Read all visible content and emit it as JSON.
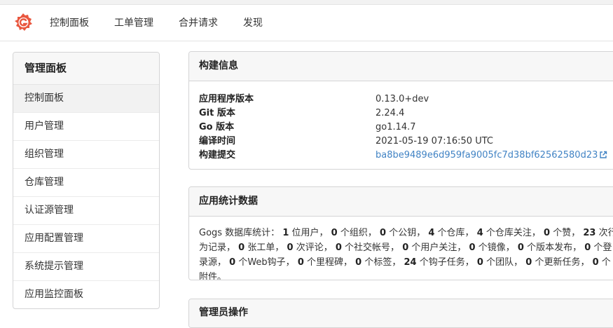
{
  "nav": {
    "items": [
      "控制面板",
      "工单管理",
      "合并请求",
      "发现"
    ]
  },
  "sidebar": {
    "title": "管理面板",
    "items": [
      {
        "label": "控制面板",
        "active": true
      },
      {
        "label": "用户管理"
      },
      {
        "label": "组织管理"
      },
      {
        "label": "仓库管理"
      },
      {
        "label": "认证源管理"
      },
      {
        "label": "应用配置管理"
      },
      {
        "label": "系统提示管理"
      },
      {
        "label": "应用监控面板"
      }
    ]
  },
  "build_info": {
    "title": "构建信息",
    "rows": [
      {
        "key": "应用程序版本",
        "value": "0.13.0+dev"
      },
      {
        "key": "Git 版本",
        "value": "2.24.4"
      },
      {
        "key": "Go 版本",
        "value": "go1.14.7"
      },
      {
        "key": "编译时间",
        "value": "2021-05-19 07:16:50 UTC"
      },
      {
        "key": "构建提交",
        "value": "ba8be9489e6d959fa9005fc7d38bf62562580d23"
      }
    ]
  },
  "app_stats": {
    "title": "应用统计数据",
    "prefix": "Gogs 数据库统计：",
    "items": [
      {
        "n": "1",
        "t": "位用户，"
      },
      {
        "n": "0",
        "t": "个组织，"
      },
      {
        "n": "0",
        "t": "个公钥，"
      },
      {
        "n": "4",
        "t": "个仓库，"
      },
      {
        "n": "4",
        "t": "个仓库关注，"
      },
      {
        "n": "0",
        "t": "个赞，"
      },
      {
        "n": "23",
        "t": "次行为记录，"
      },
      {
        "n": "0",
        "t": "张工单，"
      },
      {
        "n": "0",
        "t": "次评论，"
      },
      {
        "n": "0",
        "t": "个社交帐号，"
      },
      {
        "n": "0",
        "t": "个用户关注，"
      },
      {
        "n": "0",
        "t": "个镜像，"
      },
      {
        "n": "0",
        "t": "个版本发布，"
      },
      {
        "n": "0",
        "t": "个登录源，"
      },
      {
        "n": "0",
        "t": "个Web钩子，"
      },
      {
        "n": "0",
        "t": "个里程碑，"
      },
      {
        "n": "0",
        "t": "个标签，"
      },
      {
        "n": "24",
        "t": "个钩子任务，"
      },
      {
        "n": "0",
        "t": "个团队，"
      },
      {
        "n": "0",
        "t": "个更新任务，"
      },
      {
        "n": "0",
        "t": "个附件。"
      }
    ]
  },
  "admin_ops": {
    "title": "管理员操作"
  },
  "colors": {
    "link": "#4183c4",
    "logo": "#e9573f"
  }
}
